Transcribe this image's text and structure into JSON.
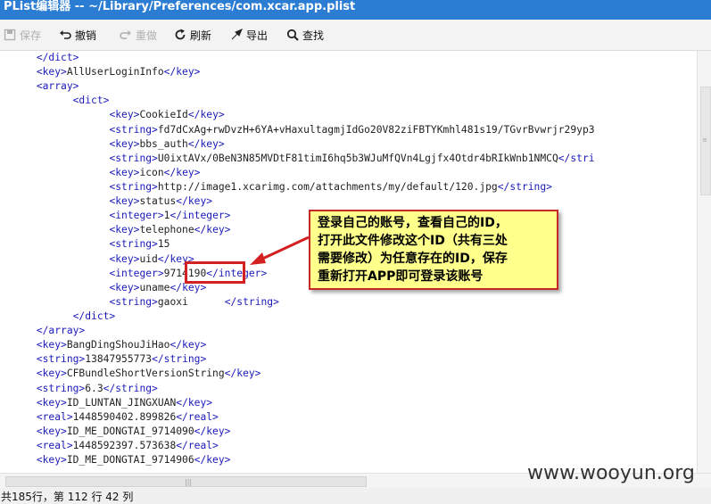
{
  "window": {
    "title": "PList编辑器  --  ~/Library/Preferences/com.xcar.app.plist"
  },
  "toolbar": {
    "save": "保存",
    "undo": "撤销",
    "redo": "重做",
    "refresh": "刷新",
    "export": "导出",
    "find": "查找"
  },
  "editor": {
    "lines": [
      {
        "pre": "      ",
        "parts": [
          [
            "t",
            "</dict>"
          ]
        ]
      },
      {
        "pre": "      ",
        "parts": [
          [
            "t",
            "<key>"
          ],
          [
            "v",
            "AllUserLoginInfo"
          ],
          [
            "t",
            "</key>"
          ]
        ]
      },
      {
        "pre": "      ",
        "parts": [
          [
            "t",
            "<array>"
          ]
        ]
      },
      {
        "pre": "            ",
        "parts": [
          [
            "t",
            "<dict>"
          ]
        ]
      },
      {
        "pre": "                  ",
        "parts": [
          [
            "t",
            "<key>"
          ],
          [
            "v",
            "CookieId"
          ],
          [
            "t",
            "</key>"
          ]
        ]
      },
      {
        "pre": "                  ",
        "parts": [
          [
            "t",
            "<string>"
          ],
          [
            "v",
            "fd7dCxAg+rwDvzH+6YA+vHaxultagmjIdGo20V82ziFBTYKmhl481s19/TGvrBvwrjr29yp3"
          ]
        ]
      },
      {
        "pre": "                  ",
        "parts": [
          [
            "t",
            "<key>"
          ],
          [
            "v",
            "bbs_auth"
          ],
          [
            "t",
            "</key>"
          ]
        ]
      },
      {
        "pre": "                  ",
        "parts": [
          [
            "t",
            "<string>"
          ],
          [
            "v",
            "U0ixtAVx/0BeN3N85MVDtF81timI6hq5b3WJuMfQVn4Lgjfx4Otdr4bRIkWnb1NMCQ"
          ],
          [
            "t",
            "</stri"
          ]
        ]
      },
      {
        "pre": "                  ",
        "parts": [
          [
            "t",
            "<key>"
          ],
          [
            "v",
            "icon"
          ],
          [
            "t",
            "</key>"
          ]
        ]
      },
      {
        "pre": "                  ",
        "parts": [
          [
            "t",
            "<string>"
          ],
          [
            "v",
            "http://image1.xcarimg.com/attachments/my/default/120.jpg"
          ],
          [
            "t",
            "</string>"
          ]
        ]
      },
      {
        "pre": "                  ",
        "parts": [
          [
            "t",
            "<key>"
          ],
          [
            "v",
            "status"
          ],
          [
            "t",
            "</key>"
          ]
        ]
      },
      {
        "pre": "                  ",
        "parts": [
          [
            "t",
            "<integer>"
          ],
          [
            "v",
            "1"
          ],
          [
            "t",
            "</integer>"
          ]
        ]
      },
      {
        "pre": "                  ",
        "parts": [
          [
            "t",
            "<key>"
          ],
          [
            "v",
            "telephone"
          ],
          [
            "t",
            "</key>"
          ]
        ]
      },
      {
        "pre": "                  ",
        "parts": [
          [
            "t",
            "<string>"
          ],
          [
            "v",
            "15"
          ]
        ]
      },
      {
        "pre": "                  ",
        "parts": [
          [
            "t",
            "<key>"
          ],
          [
            "v",
            "uid"
          ],
          [
            "t",
            "</key>"
          ]
        ]
      },
      {
        "pre": "                  ",
        "parts": [
          [
            "t",
            "<integer>"
          ],
          [
            "v",
            "9714190"
          ],
          [
            "t",
            "</integer>"
          ]
        ]
      },
      {
        "pre": "                  ",
        "parts": [
          [
            "t",
            "<key>"
          ],
          [
            "v",
            "uname"
          ],
          [
            "t",
            "</key>"
          ]
        ]
      },
      {
        "pre": "                  ",
        "parts": [
          [
            "t",
            "<string>"
          ],
          [
            "v",
            "gaoxi      "
          ],
          [
            "t",
            "</string>"
          ]
        ]
      },
      {
        "pre": "            ",
        "parts": [
          [
            "t",
            "</dict>"
          ]
        ]
      },
      {
        "pre": "      ",
        "parts": [
          [
            "t",
            "</array>"
          ]
        ]
      },
      {
        "pre": "      ",
        "parts": [
          [
            "t",
            "<key>"
          ],
          [
            "v",
            "BangDingShouJiHao"
          ],
          [
            "t",
            "</key>"
          ]
        ]
      },
      {
        "pre": "      ",
        "parts": [
          [
            "t",
            "<string>"
          ],
          [
            "v",
            "13847955773"
          ],
          [
            "t",
            "</string>"
          ]
        ]
      },
      {
        "pre": "      ",
        "parts": [
          [
            "t",
            "<key>"
          ],
          [
            "v",
            "CFBundleShortVersionString"
          ],
          [
            "t",
            "</key>"
          ]
        ]
      },
      {
        "pre": "      ",
        "parts": [
          [
            "t",
            "<string>"
          ],
          [
            "v",
            "6.3"
          ],
          [
            "t",
            "</string>"
          ]
        ]
      },
      {
        "pre": "      ",
        "parts": [
          [
            "t",
            "<key>"
          ],
          [
            "v",
            "ID_LUNTAN_JINGXUAN"
          ],
          [
            "t",
            "</key>"
          ]
        ]
      },
      {
        "pre": "      ",
        "parts": [
          [
            "t",
            "<real>"
          ],
          [
            "v",
            "1448590402.899826"
          ],
          [
            "t",
            "</real>"
          ]
        ]
      },
      {
        "pre": "      ",
        "parts": [
          [
            "t",
            "<key>"
          ],
          [
            "v",
            "ID_ME_DONGTAI_9714090"
          ],
          [
            "t",
            "</key>"
          ]
        ]
      },
      {
        "pre": "      ",
        "parts": [
          [
            "t",
            "<real>"
          ],
          [
            "v",
            "1448592397.573638"
          ],
          [
            "t",
            "</real>"
          ]
        ]
      },
      {
        "pre": "      ",
        "parts": [
          [
            "t",
            "<key>"
          ],
          [
            "v",
            "ID_ME_DONGTAI_9714906"
          ],
          [
            "t",
            "</key>"
          ]
        ]
      }
    ]
  },
  "annotation": {
    "callout_lines": [
      "登录自己的账号，查看自己的ID，",
      "打开此文件修改这个ID（共有三处",
      "需要修改）为任意存在的ID，保存",
      "重新打开APP即可登录该账号"
    ]
  },
  "status": {
    "text": "共185行，第 112 行 42 列"
  },
  "watermark": "www.wooyun.org",
  "colors": {
    "tag": "#1a1ab8",
    "callout_bg": "#ffff8c",
    "callout_border": "#c62828",
    "highlight": "#d32020"
  }
}
